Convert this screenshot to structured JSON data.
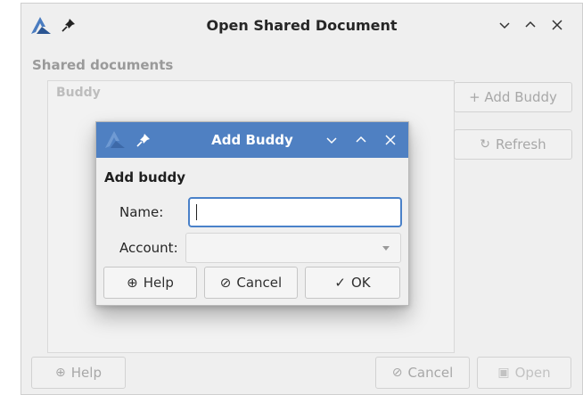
{
  "window": {
    "title": "Open Shared Document",
    "section_title": "Shared documents",
    "list_header": "Buddy",
    "add_buddy_label": "+ Add Buddy",
    "refresh_label": "Refresh",
    "help_label": "Help",
    "cancel_label": "Cancel",
    "open_label": "Open"
  },
  "dialog": {
    "title": "Add Buddy",
    "heading": "Add buddy",
    "name_label": "Name:",
    "name_value": "",
    "account_label": "Account:",
    "account_value": "",
    "help_label": "Help",
    "cancel_label": "Cancel",
    "ok_label": "OK"
  },
  "icons": {
    "app": "abiword-logo-icon",
    "pin": "pin-icon",
    "minimize": "chevron-down-icon",
    "maximize": "chevron-up-icon",
    "close": "close-icon",
    "refresh": "refresh-icon",
    "help": "help-lifebuoy-icon",
    "cancel": "cancel-icon",
    "ok": "check-icon",
    "open": "open-file-icon"
  },
  "colors": {
    "dialog_titlebar": "#4f80c2",
    "focus_border": "#4a81c9",
    "window_bg": "#efefef"
  }
}
